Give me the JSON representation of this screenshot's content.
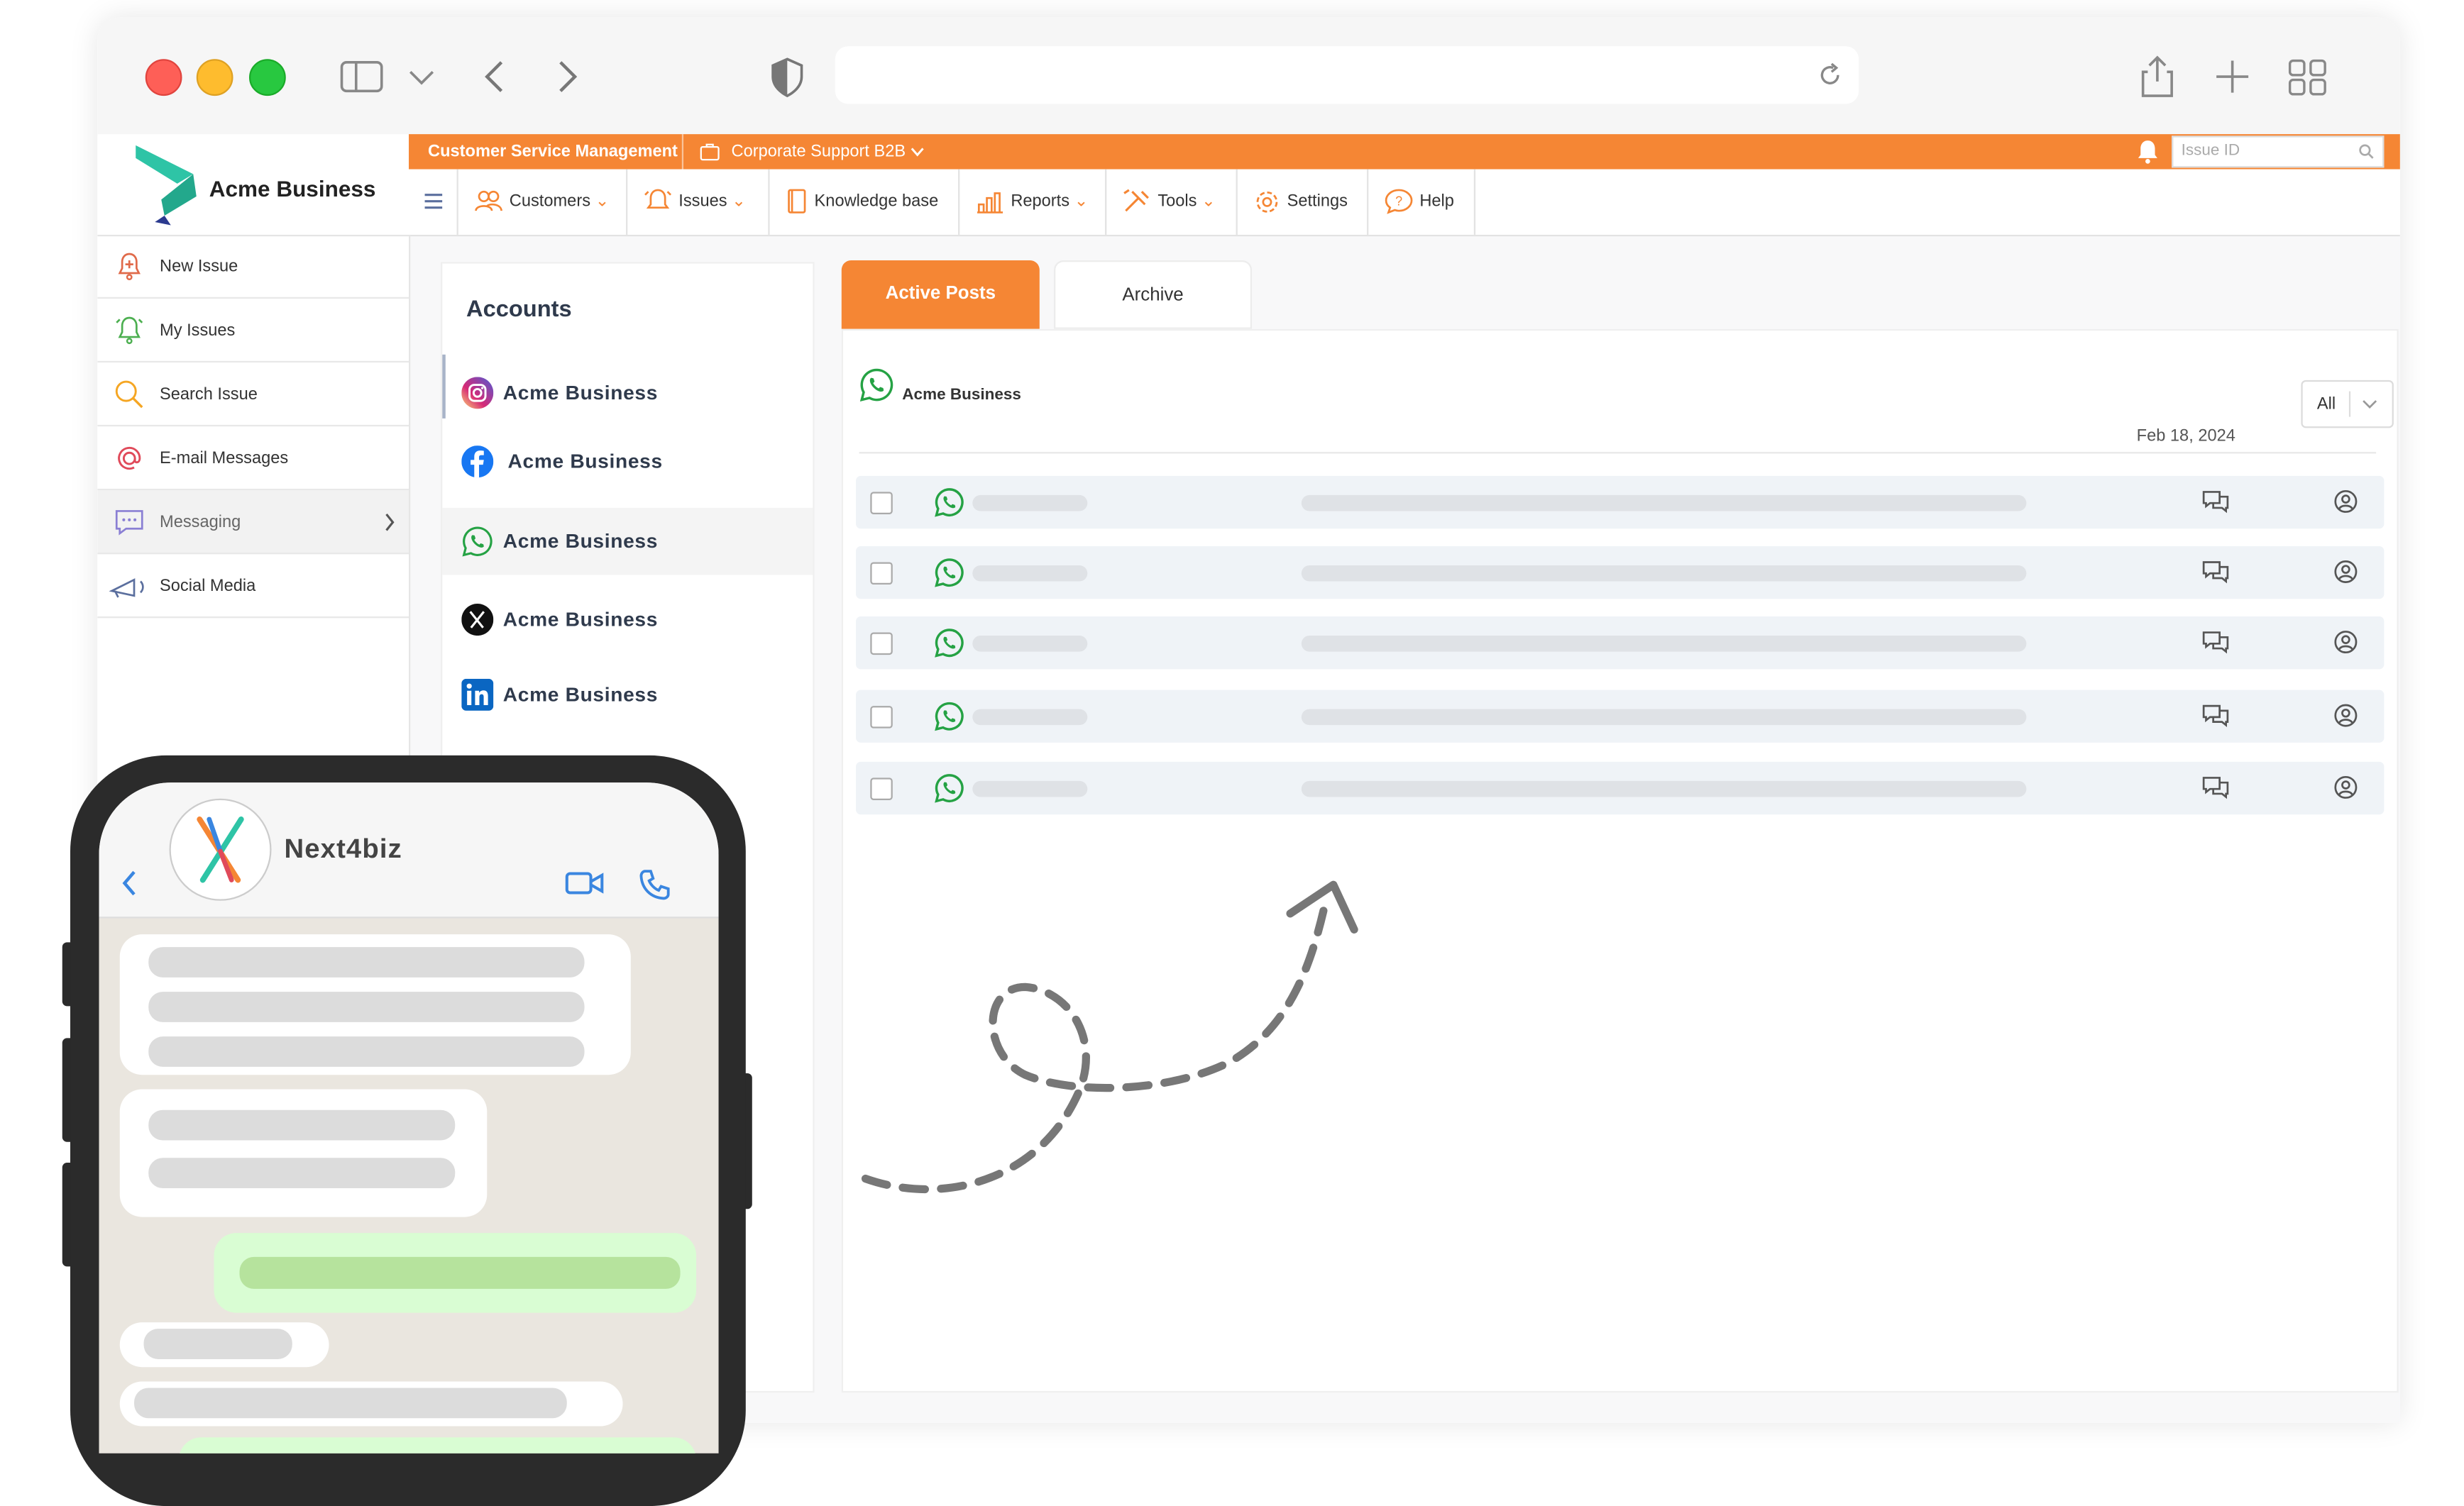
{
  "colors": {
    "accent": "#f58634",
    "whatsapp": "#25a244",
    "row_bg": "#eff3f7"
  },
  "brand": {
    "name": "Acme Business"
  },
  "topbar": {
    "module": "Customer Service Management",
    "workspace": "Corporate Support B2B",
    "issue_placeholder": "Issue ID"
  },
  "nav": {
    "customers": "Customers",
    "issues": "Issues",
    "kb": "Knowledge base",
    "reports": "Reports",
    "tools": "Tools",
    "settings": "Settings",
    "help": "Help"
  },
  "sidebar": {
    "items": [
      {
        "label": "New Issue",
        "icon": "bell-plus-icon"
      },
      {
        "label": "My Issues",
        "icon": "bell-icon"
      },
      {
        "label": "Search Issue",
        "icon": "search-icon"
      },
      {
        "label": "E-mail Messages",
        "icon": "at-icon"
      },
      {
        "label": "Messaging",
        "icon": "chat-icon"
      },
      {
        "label": "Social Media",
        "icon": "megaphone-icon"
      }
    ]
  },
  "accounts": {
    "title": "Accounts",
    "items": [
      {
        "label": "Acme Business",
        "icon": "instagram-icon"
      },
      {
        "label": "Acme Business",
        "icon": "facebook-icon"
      },
      {
        "label": "Acme Business",
        "icon": "whatsapp-icon"
      },
      {
        "label": "Acme Business",
        "icon": "x-icon"
      },
      {
        "label": "Acme Business",
        "icon": "linkedin-icon"
      }
    ]
  },
  "tabs": {
    "active": "Active Posts",
    "archive": "Archive"
  },
  "posts": {
    "account": "Acme Business",
    "filter": "All",
    "date": "Feb 18, 2024",
    "rows": 5
  },
  "phone": {
    "contact": "Next4biz"
  }
}
